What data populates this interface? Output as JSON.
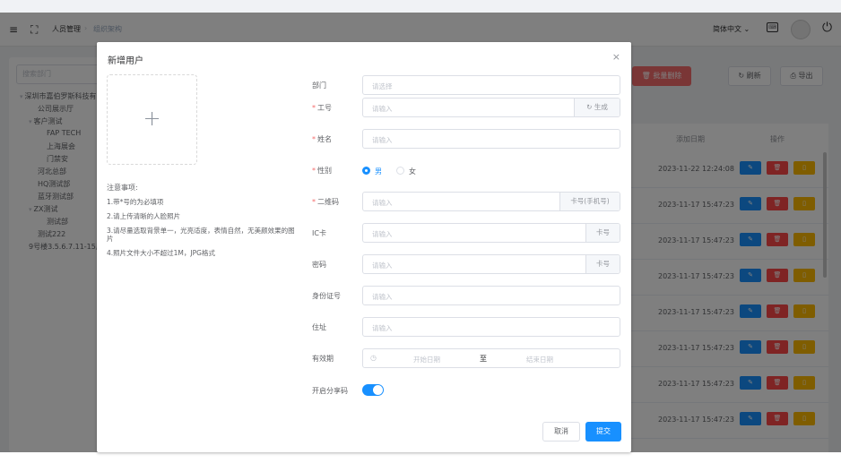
{
  "topbar": {
    "breadcrumb": [
      "人员管理",
      "组织架构"
    ],
    "language": "简体中文",
    "language_caret": "⌄"
  },
  "sidebar": {
    "search_placeholder": "搜索部门",
    "tree": [
      {
        "label": "深圳市嘉伯罗斯科技有",
        "expanded": true
      },
      {
        "label": "公司展示厅"
      },
      {
        "label": "客户测试",
        "expanded": true
      },
      {
        "label": "FAP TECH"
      },
      {
        "label": "上海展会"
      },
      {
        "label": "门禁安"
      },
      {
        "label": "河北总部"
      },
      {
        "label": "HQ测试部"
      },
      {
        "label": "蓝牙测试部"
      },
      {
        "label": "ZX测试",
        "expanded": true
      },
      {
        "label": "测试部"
      },
      {
        "label": "测试222"
      },
      {
        "label": "9号楼3.5.6.7.11-15层"
      }
    ]
  },
  "toolbar": {
    "batch_delete_label": "批量删除",
    "refresh_label": "刷新",
    "export_label": "导出"
  },
  "table": {
    "columns": {
      "added_date": "添加日期",
      "actions": "操作"
    },
    "rows": [
      {
        "added_date": "2023-11-22 12:24:08"
      },
      {
        "added_date": "2023-11-17 15:47:23"
      },
      {
        "added_date": "2023-11-17 15:47:23"
      },
      {
        "added_date": "2023-11-17 15:47:23"
      },
      {
        "added_date": "2023-11-17 15:47:23"
      },
      {
        "added_date": "2023-11-17 15:47:23"
      },
      {
        "added_date": "2023-11-17 15:47:23"
      },
      {
        "added_date": "2023-11-17 15:47:23"
      }
    ]
  },
  "dialog": {
    "title": "新增用户",
    "close_glyph": "×",
    "upload_glyph": "+",
    "notes_title": "注意事项:",
    "notes": [
      "1.带*号的为必填项",
      "2.请上传清晰的人脸照片",
      "3.请尽量选取背景单一，光亮适度，表情自然，无美颜效果的图片",
      "4.照片文件大小不超过1M，JPG格式"
    ],
    "form": {
      "department": {
        "label": "部门",
        "placeholder": "请选择"
      },
      "employee_id": {
        "label": "工号",
        "placeholder": "请输入",
        "append": "生成"
      },
      "name": {
        "label": "姓名",
        "placeholder": "请输入"
      },
      "gender": {
        "label": "性别",
        "options": [
          "男",
          "女"
        ],
        "selected": "男"
      },
      "qrcode": {
        "label": "二维码",
        "placeholder": "请输入",
        "append": "卡号(手机号)"
      },
      "ic_card": {
        "label": "IC卡",
        "placeholder": "请输入",
        "append": "卡号"
      },
      "password": {
        "label": "密码",
        "placeholder": "请输入",
        "append": "卡号"
      },
      "id_number": {
        "label": "身份证号",
        "placeholder": "请输入"
      },
      "address": {
        "label": "住址",
        "placeholder": "请输入"
      },
      "validity": {
        "label": "有效期",
        "start_placeholder": "开始日期",
        "separator": "至",
        "end_placeholder": "结束日期"
      },
      "share_code": {
        "label": "开启分享码",
        "enabled": true
      }
    },
    "cancel_label": "取消",
    "submit_label": "提交"
  },
  "colors": {
    "primary": "#1890ff",
    "danger": "#ff4949",
    "warning": "#ffba00",
    "required": "#f56c6c"
  }
}
